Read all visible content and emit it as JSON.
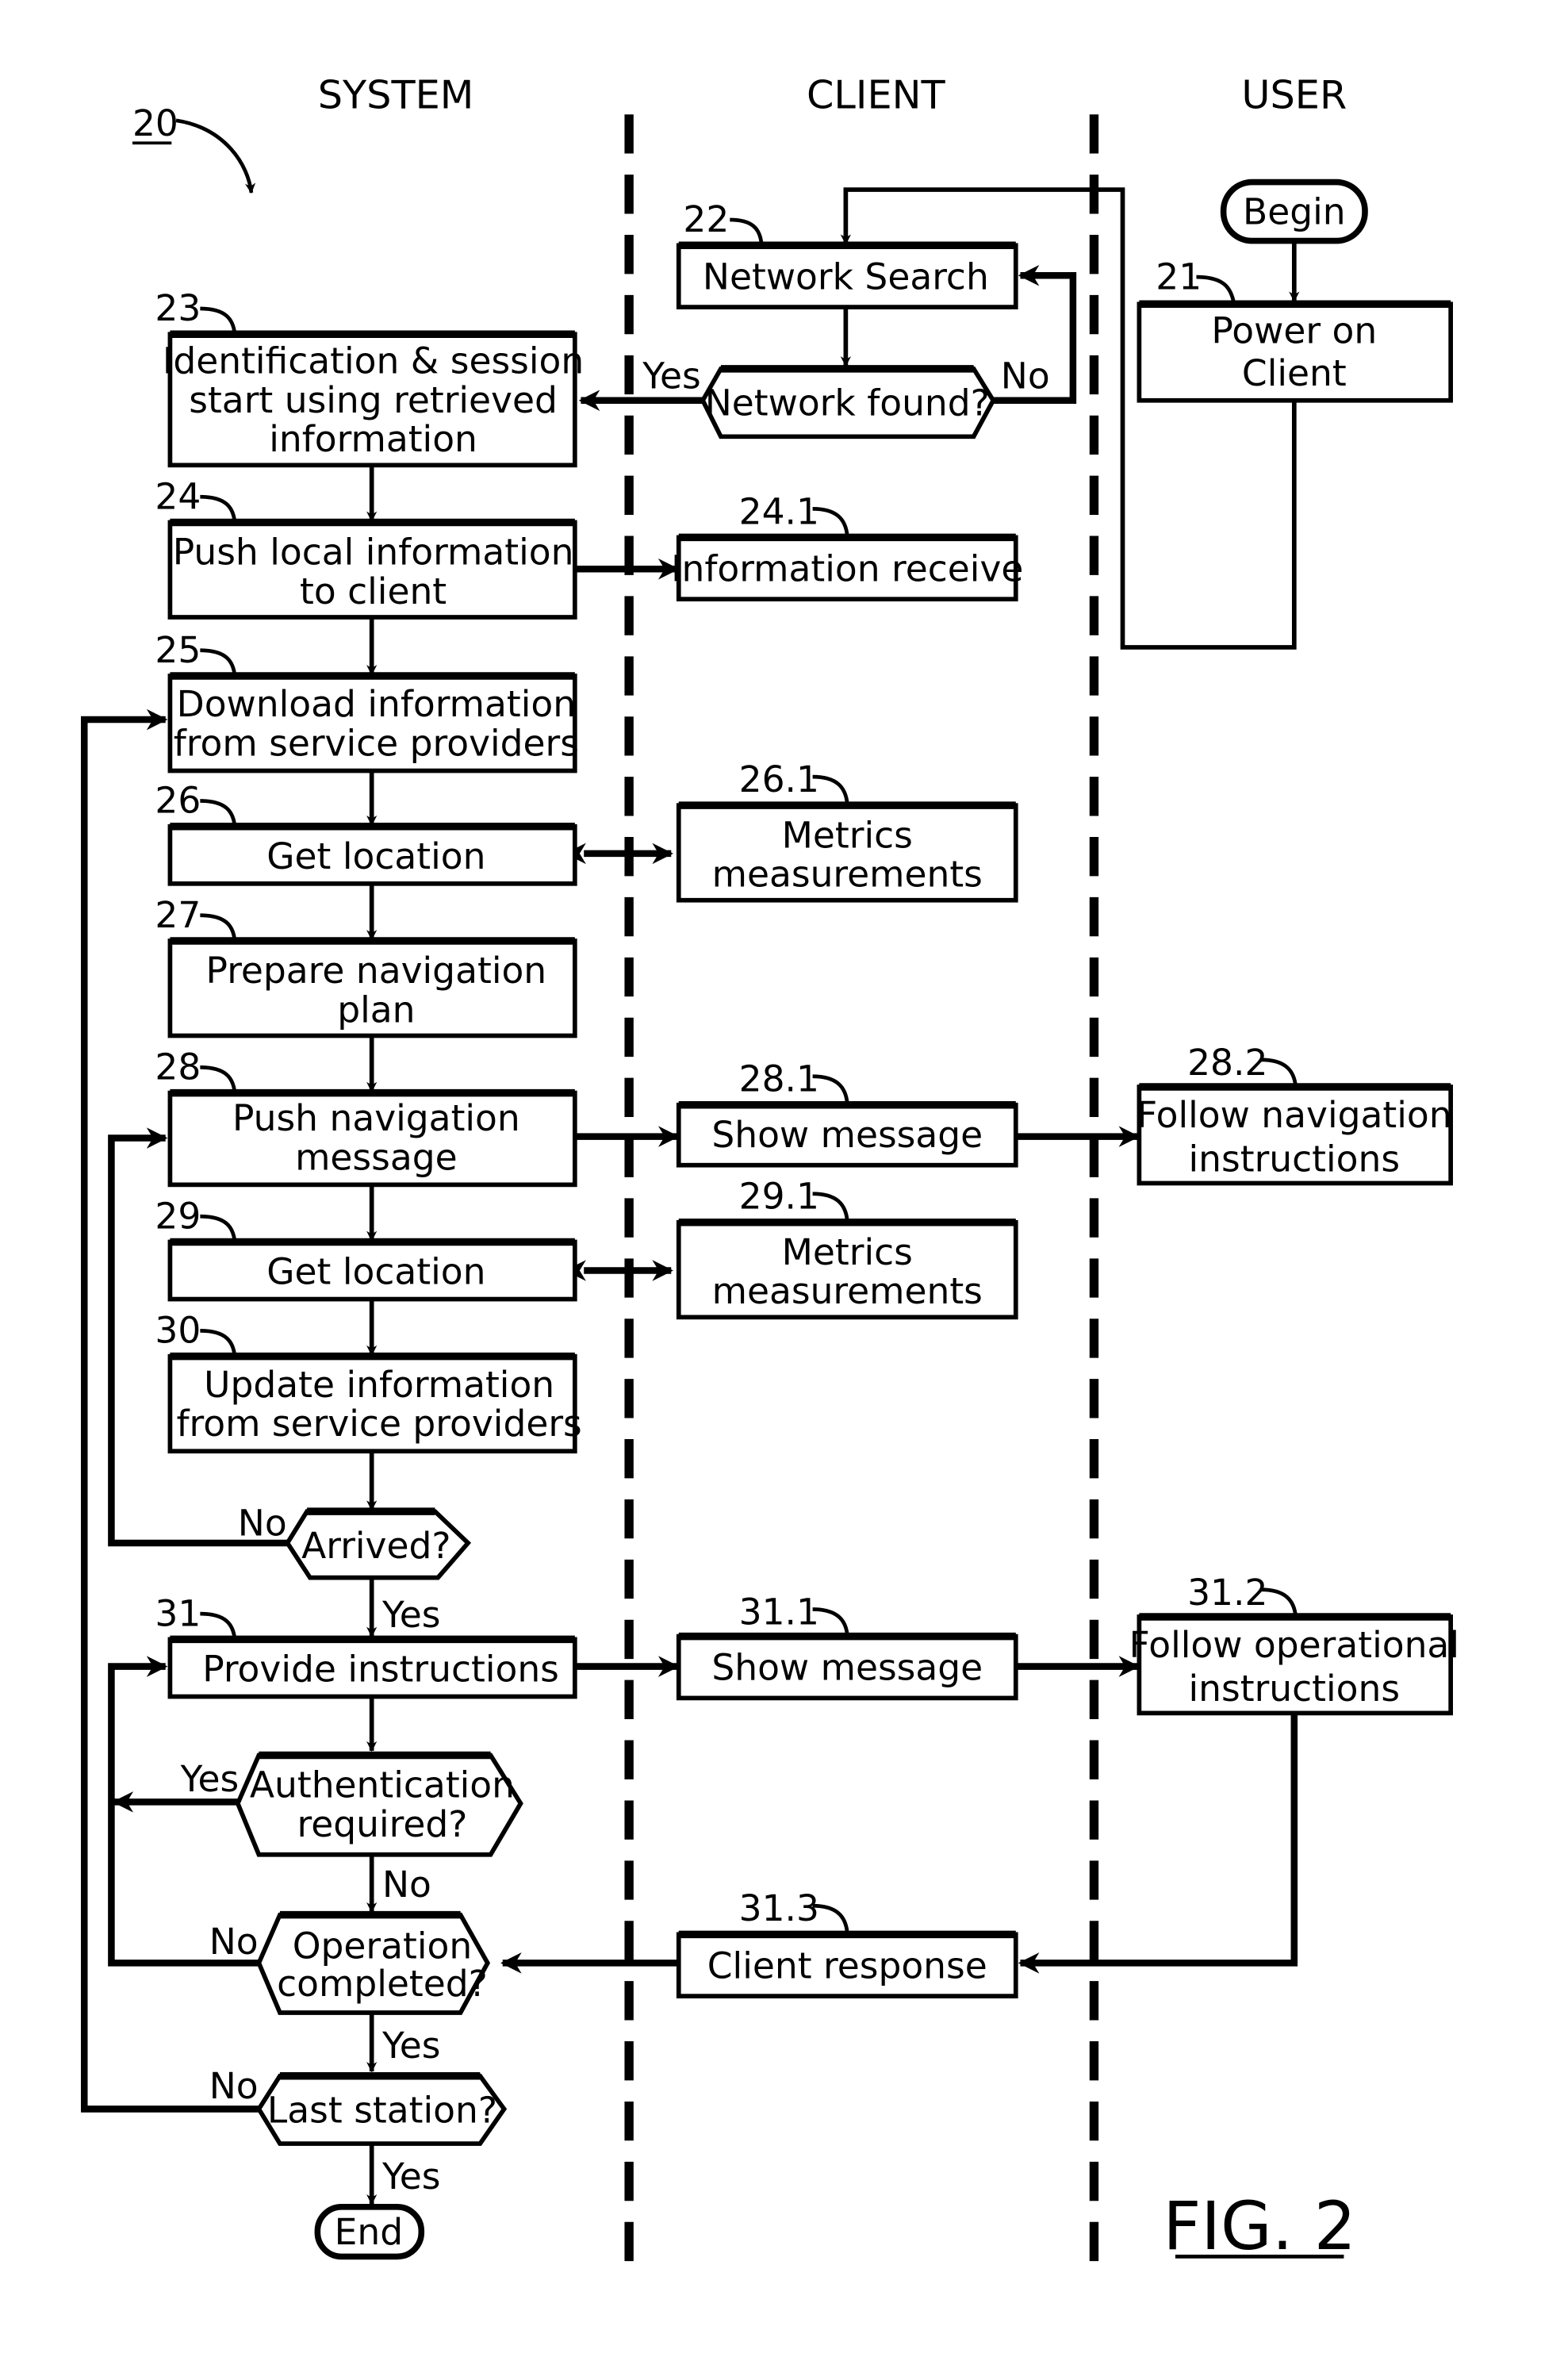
{
  "figure": {
    "ref": "20",
    "caption": "FIG. 2"
  },
  "lanes": [
    "SYSTEM",
    "CLIENT",
    "USER"
  ],
  "nodes": {
    "begin": {
      "label": "Begin"
    },
    "n21": {
      "ref": "21",
      "lines": [
        "Power on",
        "Client"
      ]
    },
    "n22": {
      "ref": "22",
      "lines": [
        "Network Search"
      ]
    },
    "network_found": {
      "lines": [
        "Network found?"
      ],
      "yes": "Yes",
      "no": "No"
    },
    "n23": {
      "ref": "23",
      "lines": [
        "Identification & session",
        "start using retrieved",
        "information"
      ]
    },
    "n24": {
      "ref": "24",
      "lines": [
        "Push local information",
        "to client"
      ]
    },
    "n24_1": {
      "ref": "24.1",
      "lines": [
        "Information receive"
      ]
    },
    "n25": {
      "ref": "25",
      "lines": [
        "Download information",
        "from service providers"
      ]
    },
    "n26": {
      "ref": "26",
      "lines": [
        "Get location"
      ]
    },
    "n26_1": {
      "ref": "26.1",
      "lines": [
        "Metrics",
        "measurements"
      ]
    },
    "n27": {
      "ref": "27",
      "lines": [
        "Prepare navigation",
        "plan"
      ]
    },
    "n28": {
      "ref": "28",
      "lines": [
        "Push navigation",
        "message"
      ]
    },
    "n28_1": {
      "ref": "28.1",
      "lines": [
        "Show message"
      ]
    },
    "n28_2": {
      "ref": "28.2",
      "lines": [
        "Follow navigation",
        "instructions"
      ]
    },
    "n29": {
      "ref": "29",
      "lines": [
        "Get location"
      ]
    },
    "n29_1": {
      "ref": "29.1",
      "lines": [
        "Metrics",
        "measurements"
      ]
    },
    "n30": {
      "ref": "30",
      "lines": [
        "Update information",
        "from service providers"
      ]
    },
    "arrived": {
      "lines": [
        "Arrived?"
      ],
      "yes": "Yes",
      "no": "No"
    },
    "n31": {
      "ref": "31",
      "lines": [
        "Provide instructions"
      ]
    },
    "n31_1": {
      "ref": "31.1",
      "lines": [
        "Show message"
      ]
    },
    "n31_2": {
      "ref": "31.2",
      "lines": [
        "Follow operational",
        "instructions"
      ]
    },
    "auth": {
      "lines": [
        "Authentication",
        "required?"
      ],
      "yes": "Yes",
      "no": "No"
    },
    "n31_3": {
      "ref": "31.3",
      "lines": [
        "Client response"
      ]
    },
    "op_done": {
      "lines": [
        "Operation",
        "completed?"
      ],
      "yes": "Yes",
      "no": "No"
    },
    "last_station": {
      "lines": [
        "Last station?"
      ],
      "yes": "Yes",
      "no": "No"
    },
    "end": {
      "label": "End"
    }
  }
}
